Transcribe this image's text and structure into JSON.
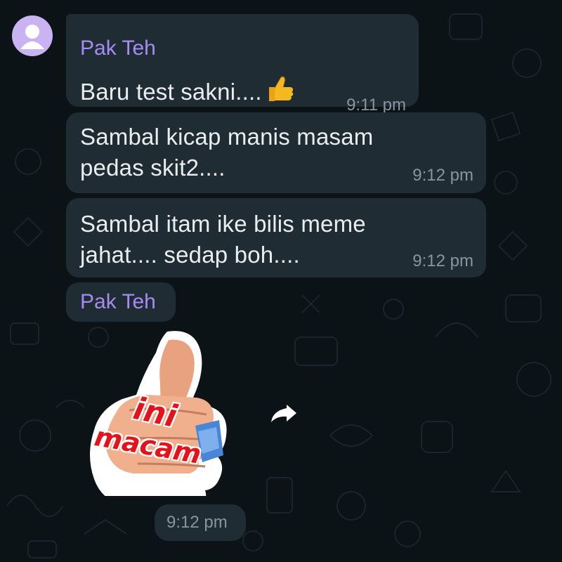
{
  "chat": {
    "messages": [
      {
        "sender": "Pak Teh",
        "lines": [
          "Baru test sakni...."
        ],
        "emoji": "thumbs-up",
        "time": "9:11 pm"
      },
      {
        "lines": [
          "Sambal kicap manis masam",
          "pedas skit2...."
        ],
        "time": "9:12 pm"
      },
      {
        "lines": [
          "Sambal itam ike bilis meme",
          "jahat.... sedap boh...."
        ],
        "time": "9:12 pm"
      }
    ],
    "sticker_message": {
      "sender": "Pak Teh",
      "sticker_text_line1": "ini",
      "sticker_text_line2": "macam",
      "time": "9:12 pm"
    }
  },
  "colors": {
    "background": "#0c1317",
    "bubble": "#1f2c34",
    "sender_name": "#a68cf0",
    "message_text": "#e9edef",
    "timestamp": "#8696a0",
    "avatar": "#c9b3f2"
  },
  "icons": {
    "avatar": "person-silhouette-icon",
    "forward": "forward-share-icon",
    "emoji": "thumbs-up-emoji-icon"
  }
}
